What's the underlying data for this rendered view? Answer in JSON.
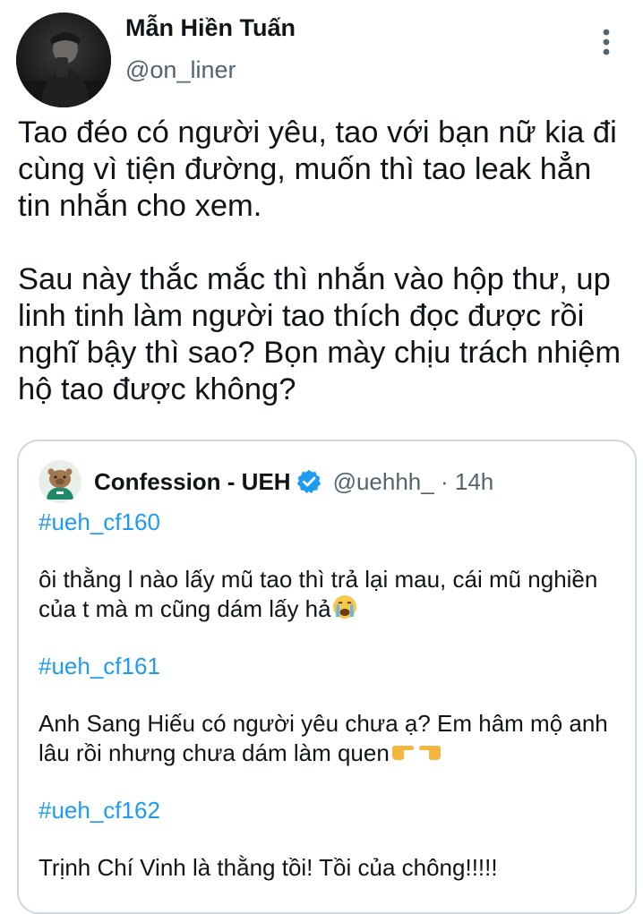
{
  "author": {
    "display_name": "Mẫn Hiền Tuấn",
    "handle": "@on_liner",
    "avatar_icon": "profile-photo"
  },
  "menu_icon": "more-vertical-icon",
  "tweet": {
    "text": "Tao đéo có người yêu, tao với bạn nữ kia đi\ncùng vì tiện đường, muốn thì tao leak hẳn\ntin nhắn cho xem.\n\nSau này thắc mắc thì nhắn vào hộp thư, up\nlinh tinh làm người tao thích đọc được rồi\nnghĩ bậy thì sao? Bọn mày chịu trách nhiệm\nhộ tao được không?"
  },
  "quoted_tweet": {
    "display_name": "Confession - UEH",
    "verified_icon": "verified-badge-icon",
    "handle": "@uehhh_",
    "separator": "·",
    "time": "14h",
    "posts": [
      {
        "hashtag": "#ueh_cf160",
        "text": "ôi thằng l nào lấy mũ tao thì trả lại mau, cái mũ nghiền của t mà m cũng dám lấy hả",
        "emoji": "crying-face-emoji"
      },
      {
        "hashtag": "#ueh_cf161",
        "text": "Anh Sang Hiếu có người yêu chưa ạ? Em hâm mộ anh lâu rồi nhưng chưa dám làm quen",
        "emoji": "pointing-hands-emoji"
      },
      {
        "hashtag": "#ueh_cf162",
        "text": "Trịnh Chí Vinh là thằng tồi! Tồi của chông!!!!!"
      }
    ]
  },
  "colors": {
    "text": "#0f1419",
    "secondary": "#536471",
    "link": "#1d9bf0",
    "border": "#cfd9de"
  }
}
